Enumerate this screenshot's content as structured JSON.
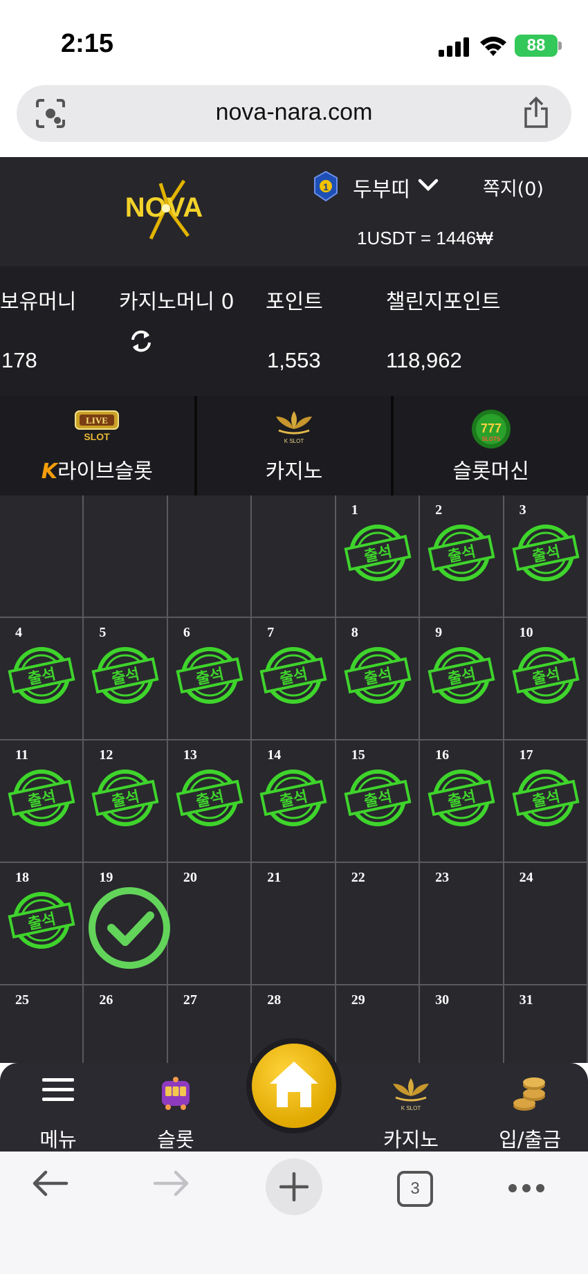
{
  "status_bar": {
    "time": "2:15",
    "battery": "88"
  },
  "browser": {
    "url": "nova-nara.com",
    "tab_count": "3"
  },
  "header": {
    "logo_text": "NOVA",
    "level": "1",
    "username": "두부띠",
    "messages": "쪽지(0)",
    "rate": "1USDT = 1446₩"
  },
  "balances": {
    "money_label": "보유머니",
    "money_value": "178",
    "casino_label": "카지노머니 0",
    "point_label": "포인트",
    "point_value": "1,553",
    "challenge_label": "챌린지포인트",
    "challenge_value": "118,962"
  },
  "game_tabs": {
    "live_slot": {
      "label": "라이브슬롯",
      "icon_text": "LIVE",
      "icon_sub": "SLOT",
      "prefix": "K"
    },
    "casino": {
      "label": "카지노",
      "icon_sub": "K SLOT"
    },
    "slot_machine": {
      "label": "슬롯머신",
      "icon_text": "777",
      "icon_sub": "SLOTS"
    }
  },
  "calendar": {
    "stamp_text": "출석",
    "attended_days": [
      "1",
      "2",
      "3",
      "4",
      "5",
      "6",
      "7",
      "8",
      "9",
      "10",
      "11",
      "12",
      "13",
      "14",
      "15",
      "16",
      "17",
      "18"
    ],
    "today": "19",
    "other_days": [
      "20",
      "21",
      "22",
      "23",
      "24",
      "25",
      "26",
      "27",
      "28",
      "29",
      "30",
      "31"
    ]
  },
  "bottom_nav": {
    "menu": "메뉴",
    "slot": "슬롯",
    "casino": "카지노",
    "deposit": "입/출금"
  },
  "colors": {
    "stamp_green": "#3fd42c",
    "check_green": "#63d45a",
    "home_gold": "#f2b705",
    "header_bg": "#26262b"
  }
}
